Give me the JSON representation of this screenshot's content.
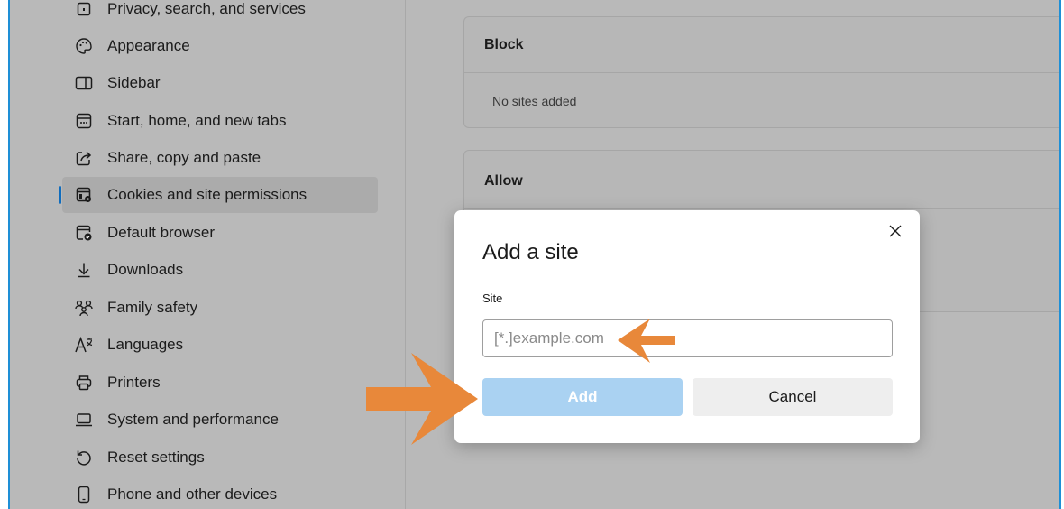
{
  "sidebar": {
    "items": [
      {
        "label": "Privacy, search, and services",
        "icon": "lock-icon"
      },
      {
        "label": "Appearance",
        "icon": "palette-icon"
      },
      {
        "label": "Sidebar",
        "icon": "sidebar-icon"
      },
      {
        "label": "Start, home, and new tabs",
        "icon": "home-tab-icon"
      },
      {
        "label": "Share, copy and paste",
        "icon": "share-icon"
      },
      {
        "label": "Cookies and site permissions",
        "icon": "cookie-permissions-icon",
        "active": true
      },
      {
        "label": "Default browser",
        "icon": "default-browser-icon"
      },
      {
        "label": "Downloads",
        "icon": "download-icon"
      },
      {
        "label": "Family safety",
        "icon": "family-icon"
      },
      {
        "label": "Languages",
        "icon": "language-icon"
      },
      {
        "label": "Printers",
        "icon": "printer-icon"
      },
      {
        "label": "System and performance",
        "icon": "laptop-icon"
      },
      {
        "label": "Reset settings",
        "icon": "reset-icon"
      },
      {
        "label": "Phone and other devices",
        "icon": "phone-icon"
      }
    ]
  },
  "main": {
    "block": {
      "title": "Block",
      "empty_text": "No sites added"
    },
    "allow": {
      "title": "Allow"
    }
  },
  "dialog": {
    "title": "Add a site",
    "site_label": "Site",
    "site_placeholder": "[*.]example.com",
    "site_value": "",
    "add_label": "Add",
    "cancel_label": "Cancel"
  },
  "colors": {
    "accent": "#0f6cbd",
    "frame": "#1e8fd6",
    "annotation_arrow": "#e8883a",
    "add_button_disabled": "#aad2f2"
  }
}
